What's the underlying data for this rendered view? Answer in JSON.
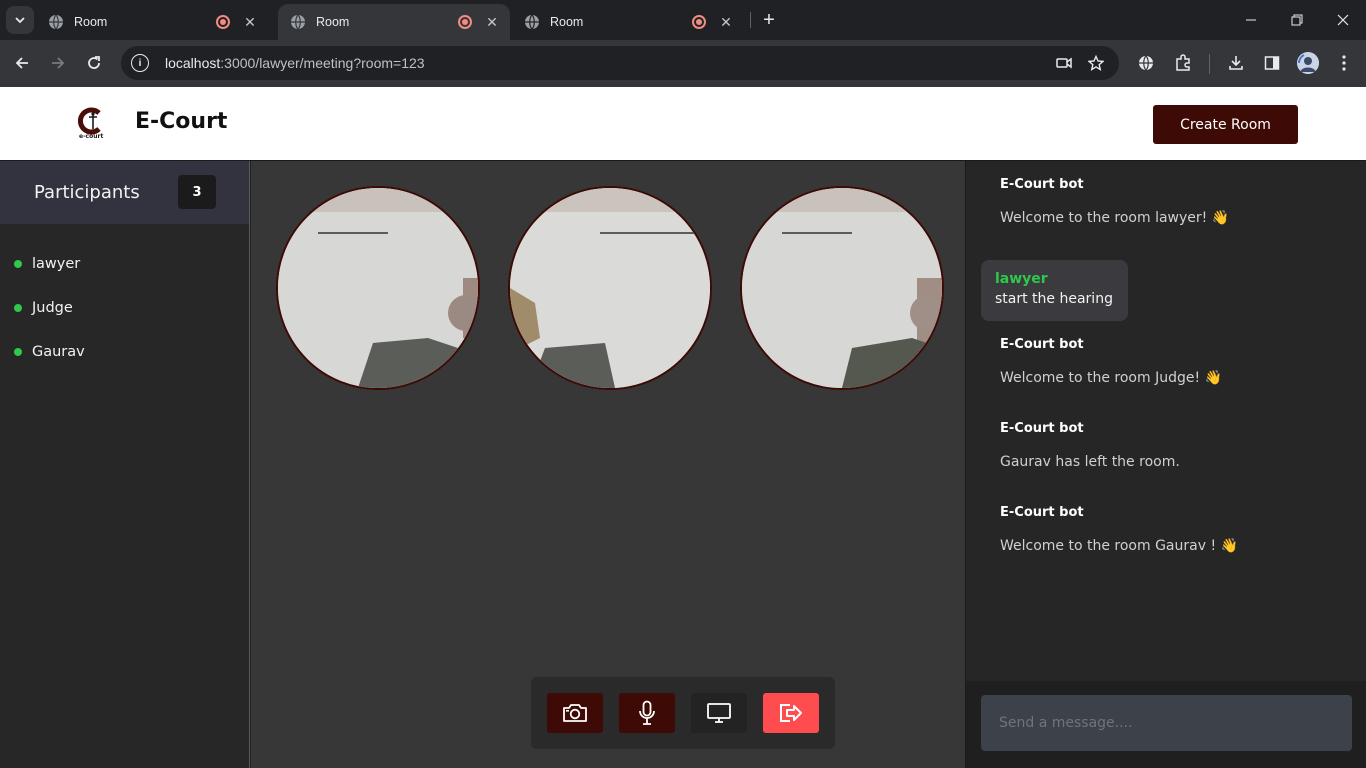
{
  "browser": {
    "tabs": [
      {
        "title": "Room",
        "active": false
      },
      {
        "title": "Room",
        "active": true
      },
      {
        "title": "Room",
        "active": false
      }
    ],
    "url_host": "localhost",
    "url_path": ":3000/lawyer/meeting?room=123"
  },
  "header": {
    "logo_text": "e-court",
    "brand": "E-Court",
    "create_room_label": "Create Room"
  },
  "sidebar": {
    "title": "Participants",
    "count": "3",
    "participants": [
      {
        "name": "lawyer",
        "status_color": "#2ec84b"
      },
      {
        "name": "Judge",
        "status_color": "#2ec84b"
      },
      {
        "name": "Gaurav",
        "status_color": "#2ec84b"
      }
    ]
  },
  "chat": {
    "messages": [
      {
        "sender": "E-Court bot",
        "text": "Welcome to the room lawyer! 👋"
      },
      {
        "sender": "lawyer",
        "text": "start the hearing"
      },
      {
        "sender": "E-Court bot",
        "text": "Welcome to the room Judge! 👋"
      },
      {
        "sender": "E-Court bot",
        "text": "Gaurav has left the room."
      },
      {
        "sender": "E-Court bot",
        "text": "Welcome to the room Gaurav ! 👋"
      }
    ],
    "input_placeholder": "Send a message...."
  },
  "controls": {
    "camera_icon": "camera-icon",
    "mic_icon": "microphone-icon",
    "screen_icon": "monitor-icon",
    "leave_icon": "exit-icon"
  },
  "colors": {
    "brand_dark": "#3d0a05",
    "online": "#2ec84b",
    "leave": "#ff4d4f"
  }
}
